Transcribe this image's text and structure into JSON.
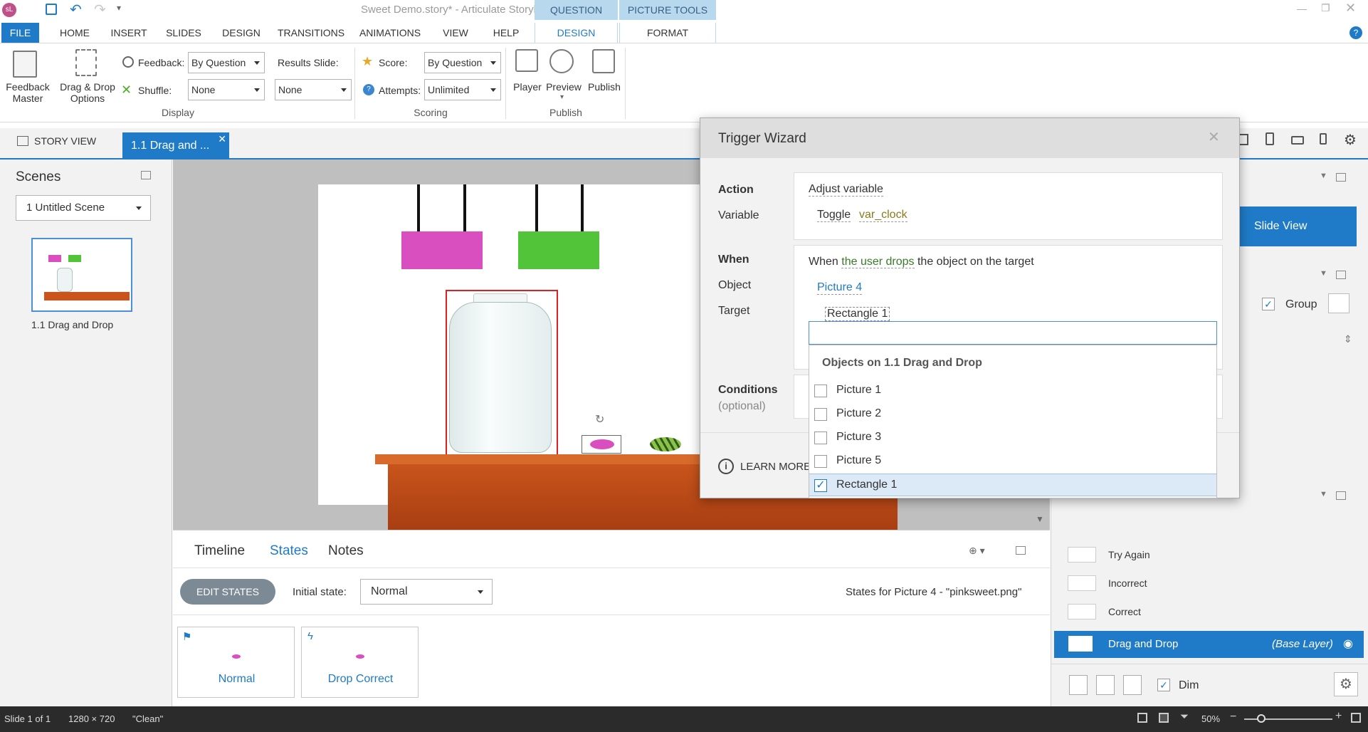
{
  "window": {
    "title": "Sweet Demo.story* -  Articulate Storyline",
    "context_tab_groups": [
      "QUESTION TOOLS",
      "PICTURE TOOLS"
    ]
  },
  "tabs": [
    "FILE",
    "HOME",
    "INSERT",
    "SLIDES",
    "DESIGN",
    "TRANSITIONS",
    "ANIMATIONS",
    "VIEW",
    "HELP",
    "DESIGN",
    "FORMAT"
  ],
  "ribbon": {
    "feedback_master": "Feedback Master",
    "drag_drop_options_1": "Drag & Drop",
    "drag_drop_options_2": "Options",
    "feedback_label": "Feedback:",
    "feedback_value": "By Question",
    "shuffle_label": "Shuffle:",
    "shuffle_value": "None",
    "results_slide_label": "Results Slide:",
    "results_slide_value": "None",
    "score_label": "Score:",
    "score_value": "By Question",
    "attempts_label": "Attempts:",
    "attempts_value": "Unlimited",
    "player": "Player",
    "preview": "Preview",
    "publish": "Publish",
    "groups": {
      "display": "Display",
      "scoring": "Scoring",
      "publish": "Publish"
    }
  },
  "doc_tabs": {
    "story_view": "STORY VIEW",
    "slide_tab": "1.1 Drag and ..."
  },
  "scenes": {
    "title": "Scenes",
    "dropdown": "1 Untitled Scene",
    "slide_label": "1.1 Drag and Drop"
  },
  "states_panel": {
    "tabs": [
      "Timeline",
      "States",
      "Notes"
    ],
    "edit_states": "EDIT STATES",
    "initial_state_label": "Initial state:",
    "initial_state_value": "Normal",
    "states_for": "States for Picture 4 - \"pinksweet.png\"",
    "state_cards": [
      "Normal",
      "Drop Correct"
    ]
  },
  "right_panel": {
    "slide_view": "Slide View",
    "group": "Group",
    "layers": [
      "Try Again",
      "Incorrect",
      "Correct"
    ],
    "base_layer": "Drag and Drop",
    "base_layer_tag": "(Base Layer)",
    "dim": "Dim"
  },
  "wizard": {
    "title": "Trigger Wizard",
    "action_label": "Action",
    "action_value": "Adjust variable",
    "variable_label": "Variable",
    "variable_op": "Toggle",
    "variable_name": "var_clock",
    "when_label": "When",
    "when_prefix": "When",
    "when_event": "the user drops",
    "when_suffix": "the object on the target",
    "object_label": "Object",
    "object_value": "Picture 4",
    "target_label": "Target",
    "target_value": "Rectangle 1",
    "conditions_label": "Conditions",
    "conditions_optional": "(optional)",
    "learn_more": "LEARN MORE"
  },
  "dropdown": {
    "search_value": "",
    "header": "Objects on 1.1 Drag and Drop",
    "options": [
      {
        "label": "Picture 1",
        "checked": false
      },
      {
        "label": "Picture 2",
        "checked": false
      },
      {
        "label": "Picture 3",
        "checked": false
      },
      {
        "label": "Picture 5",
        "checked": false
      },
      {
        "label": "Rectangle 1",
        "checked": true
      }
    ]
  },
  "status": {
    "slide": "Slide 1 of 1",
    "size": "1280 × 720",
    "theme": "\"Clean\"",
    "zoom": "50%"
  },
  "colors": {
    "accent": "#1f7bc8",
    "context_tab": "#b8d8ee",
    "pink_block": "#d94fbf",
    "green_block": "#52c43a",
    "shelf": "#c9541c"
  }
}
